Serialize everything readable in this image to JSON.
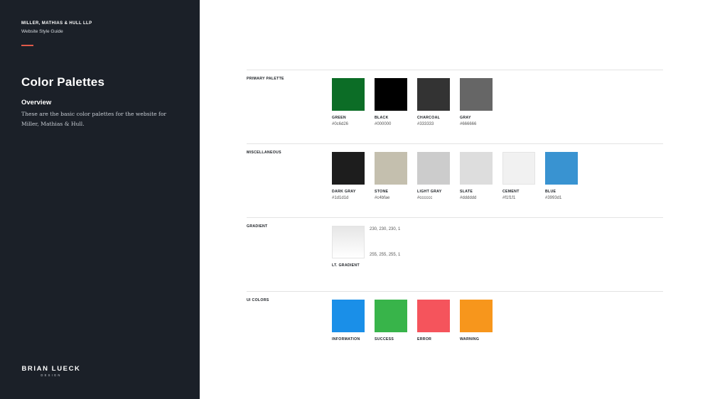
{
  "sidebar": {
    "company": "MILLER, MATHIAS & HULL LLP",
    "guide": "Website Style Guide",
    "title": "Color Palettes",
    "overview_heading": "Overview",
    "overview_text": "These are the basic color palettes for the website for Miller, Mathias & Hull.",
    "brand_name": "BRIAN LUECK",
    "brand_sub": "DESIGN",
    "accent_color": "#e05a4a"
  },
  "sections": {
    "primary": {
      "label": "PRIMARY PALETTE",
      "swatches": [
        {
          "name": "GREEN",
          "hex": "#0c6d26"
        },
        {
          "name": "BLACK",
          "hex": "#000000"
        },
        {
          "name": "CHARCOAL",
          "hex": "#333333"
        },
        {
          "name": "GRAY",
          "hex": "#666666"
        }
      ]
    },
    "misc": {
      "label": "MISCELLANEOUS",
      "swatches": [
        {
          "name": "DARK GRAY",
          "hex": "#1d1d1d"
        },
        {
          "name": "STONE",
          "hex": "#c4bfae"
        },
        {
          "name": "LIGHT GRAY",
          "hex": "#cccccc"
        },
        {
          "name": "SLATE",
          "hex": "#dddddd"
        },
        {
          "name": "CEMENT",
          "hex": "#f1f1f1"
        },
        {
          "name": "BLUE",
          "hex": "#3993d1"
        }
      ]
    },
    "gradient": {
      "label": "GRADIENT",
      "name": "LT. GRADIENT",
      "start": "230, 230, 230, 1",
      "end": "255, 255, 255, 1"
    },
    "ui": {
      "label": "UI COLORS",
      "swatches": [
        {
          "name": "INFORMATION",
          "color": "#1a8fe8"
        },
        {
          "name": "SUCCESS",
          "color": "#38b44a"
        },
        {
          "name": "ERROR",
          "color": "#f5545c"
        },
        {
          "name": "WARNING",
          "color": "#f7961c"
        }
      ]
    }
  }
}
